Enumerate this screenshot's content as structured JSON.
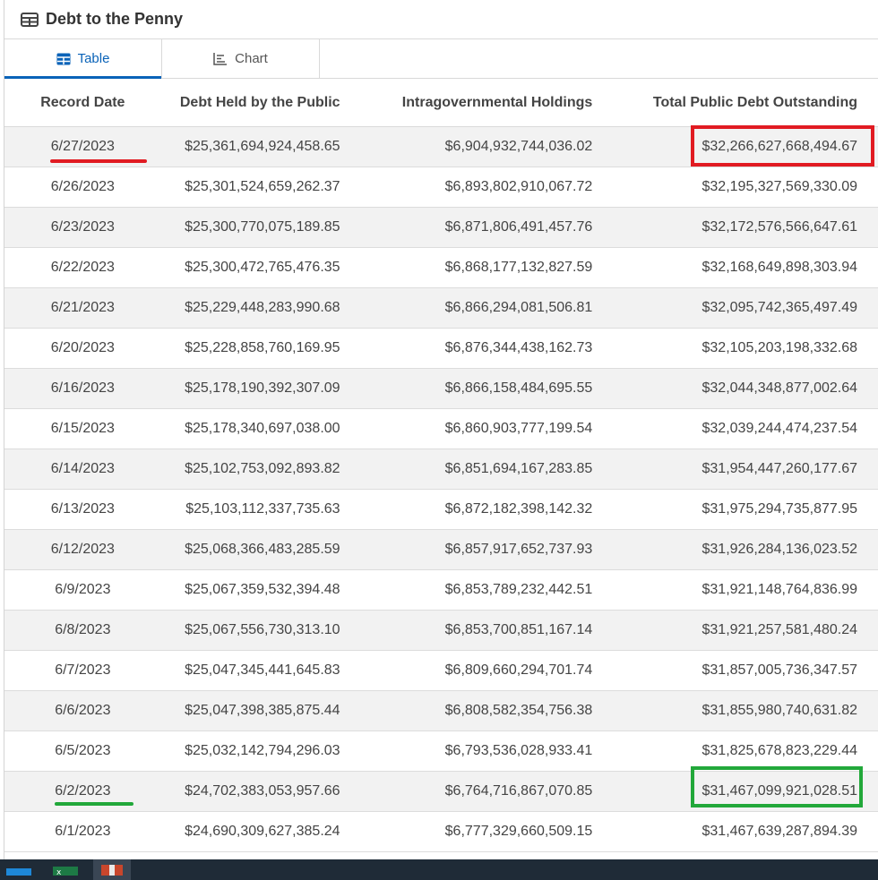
{
  "header": {
    "title": "Debt to the Penny",
    "icon": "table-icon"
  },
  "tabs": [
    {
      "label": "Table",
      "icon": "table-icon",
      "active": true
    },
    {
      "label": "Chart",
      "icon": "chart-icon",
      "active": false
    }
  ],
  "table": {
    "columns": [
      "Record Date",
      "Debt Held by the Public",
      "Intragovernmental Holdings",
      "Total Public Debt Outstanding"
    ],
    "rows": [
      [
        "6/27/2023",
        "$25,361,694,924,458.65",
        "$6,904,932,744,036.02",
        "$32,266,627,668,494.67"
      ],
      [
        "6/26/2023",
        "$25,301,524,659,262.37",
        "$6,893,802,910,067.72",
        "$32,195,327,569,330.09"
      ],
      [
        "6/23/2023",
        "$25,300,770,075,189.85",
        "$6,871,806,491,457.76",
        "$32,172,576,566,647.61"
      ],
      [
        "6/22/2023",
        "$25,300,472,765,476.35",
        "$6,868,177,132,827.59",
        "$32,168,649,898,303.94"
      ],
      [
        "6/21/2023",
        "$25,229,448,283,990.68",
        "$6,866,294,081,506.81",
        "$32,095,742,365,497.49"
      ],
      [
        "6/20/2023",
        "$25,228,858,760,169.95",
        "$6,876,344,438,162.73",
        "$32,105,203,198,332.68"
      ],
      [
        "6/16/2023",
        "$25,178,190,392,307.09",
        "$6,866,158,484,695.55",
        "$32,044,348,877,002.64"
      ],
      [
        "6/15/2023",
        "$25,178,340,697,038.00",
        "$6,860,903,777,199.54",
        "$32,039,244,474,237.54"
      ],
      [
        "6/14/2023",
        "$25,102,753,092,893.82",
        "$6,851,694,167,283.85",
        "$31,954,447,260,177.67"
      ],
      [
        "6/13/2023",
        "$25,103,112,337,735.63",
        "$6,872,182,398,142.32",
        "$31,975,294,735,877.95"
      ],
      [
        "6/12/2023",
        "$25,068,366,483,285.59",
        "$6,857,917,652,737.93",
        "$31,926,284,136,023.52"
      ],
      [
        "6/9/2023",
        "$25,067,359,532,394.48",
        "$6,853,789,232,442.51",
        "$31,921,148,764,836.99"
      ],
      [
        "6/8/2023",
        "$25,067,556,730,313.10",
        "$6,853,700,851,167.14",
        "$31,921,257,581,480.24"
      ],
      [
        "6/7/2023",
        "$25,047,345,441,645.83",
        "$6,809,660,294,701.74",
        "$31,857,005,736,347.57"
      ],
      [
        "6/6/2023",
        "$25,047,398,385,875.44",
        "$6,808,582,354,756.38",
        "$31,855,980,740,631.82"
      ],
      [
        "6/5/2023",
        "$25,032,142,794,296.03",
        "$6,793,536,028,933.41",
        "$31,825,678,823,229.44"
      ],
      [
        "6/2/2023",
        "$24,702,383,053,957.66",
        "$6,764,716,867,070.85",
        "$31,467,099,921,028.51"
      ],
      [
        "6/1/2023",
        "$24,690,309,627,385.24",
        "$6,777,329,660,509.15",
        "$31,467,639,287,894.39"
      ]
    ]
  },
  "annotations": {
    "red_color": "#e11b22",
    "green_color": "#22a83a"
  },
  "taskbar": {
    "apps": [
      "network-icon",
      "excel-icon",
      "powerpoint-icon"
    ]
  }
}
